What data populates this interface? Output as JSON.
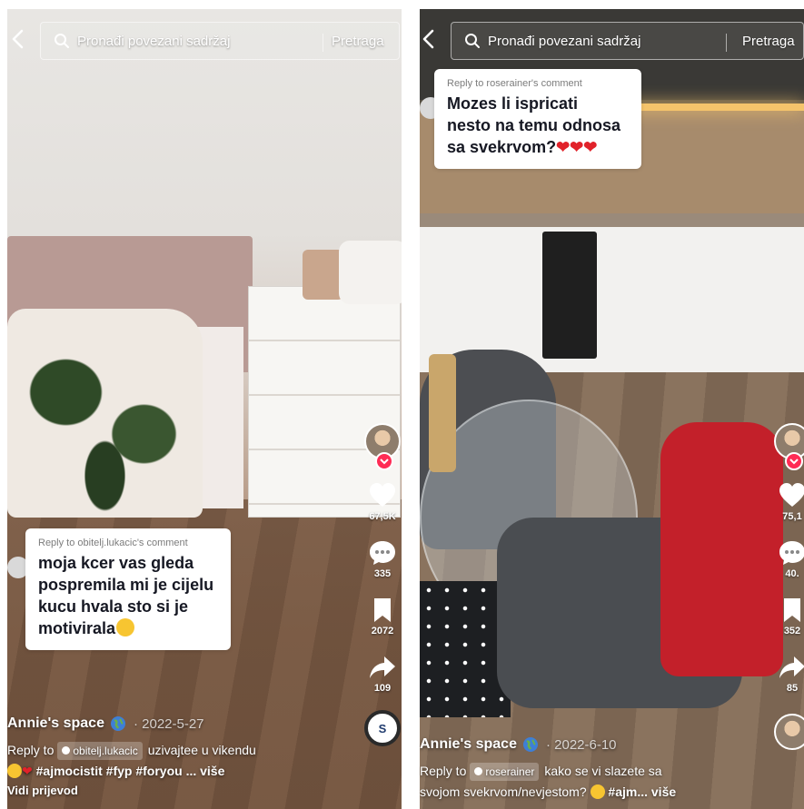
{
  "search": {
    "placeholder": "Pronađi povezani sadržaj",
    "button_label": "Pretraga"
  },
  "left_video": {
    "reply": {
      "label": "Reply to obitelj.lukacic's comment",
      "text_lines": [
        "moja kcer vas gleda",
        "pospremila mi je cijelu",
        "kucu hvala sto si je",
        "motivirala"
      ]
    },
    "actions": {
      "likes": "67,5K",
      "comments": "335",
      "saves": "2072",
      "shares": "109"
    },
    "author": "Annie's space",
    "date": "· 2022-5-27",
    "reply_prefix": "Reply to",
    "mention": "obitelj.lukacic",
    "desc_rest": "uzivajtee u vikendu",
    "hashtags": "#ajmocistit #fyp #foryou",
    "more": "... više",
    "translate": "Vidi prijevod",
    "music_disc_letter": "S"
  },
  "right_video": {
    "reply": {
      "label": "Reply to roserainer's comment",
      "text_lines": [
        "Mozes li ispricati",
        "nesto na temu odnosa",
        "sa svekrvom?"
      ]
    },
    "actions": {
      "likes": "75,1",
      "comments": "40.",
      "saves": "352",
      "shares": "85"
    },
    "author": "Annie's space",
    "date": "· 2022-6-10",
    "reply_prefix": "Reply to",
    "mention": "roserainer",
    "desc_rest": "kako se vi slazete sa",
    "desc_line2": "svojom svekrvom/nevjestom?",
    "hashtags": "#ajm...",
    "more": "više"
  },
  "colors": {
    "accent_follow": "#fe2c55",
    "heart": "#e1222a",
    "text_white": "#ffffff"
  }
}
